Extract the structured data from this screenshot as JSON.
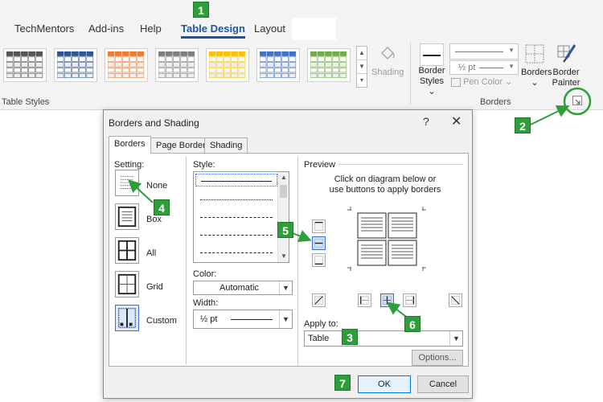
{
  "ribbon": {
    "tabs": [
      "TechMentors",
      "Add-ins",
      "Help",
      "Table Design",
      "Layout"
    ],
    "active_tab": "Table Design",
    "group_table_styles_label": "Table Styles",
    "shading_label": "Shading",
    "border_styles_label_1": "Border",
    "border_styles_label_2": "Styles",
    "pen_weight": "½ pt",
    "pen_color_label": "Pen Color",
    "borders_label": "Borders",
    "border_painter_label_1": "Border",
    "border_painter_label_2": "Painter",
    "group_borders_label": "Borders",
    "style_colors": [
      "#555555",
      "#2f5597",
      "#ed7d31",
      "#7f7f7f",
      "#ffc000",
      "#4472c4",
      "#70ad47"
    ]
  },
  "dialog": {
    "title": "Borders and Shading",
    "help_icon": "?",
    "close_icon": "✕",
    "tabs": [
      "Borders",
      "Page Border",
      "Shading"
    ],
    "setting_label": "Setting:",
    "settings": [
      "None",
      "Box",
      "All",
      "Grid",
      "Custom"
    ],
    "style_label": "Style:",
    "color_label": "Color:",
    "color_value": "Automatic",
    "width_label": "Width:",
    "width_value": "½ pt",
    "preview_label": "Preview",
    "preview_hint_1": "Click on diagram below or",
    "preview_hint_2": "use buttons to apply borders",
    "apply_to_label": "Apply to:",
    "apply_to_value": "Table",
    "options_button": "Options...",
    "ok_button": "OK",
    "cancel_button": "Cancel",
    "selection_color": "#3a6fd8"
  },
  "callouts": [
    "1",
    "2",
    "3",
    "4",
    "5",
    "6",
    "7"
  ],
  "callout_color": "#2e9e3a"
}
